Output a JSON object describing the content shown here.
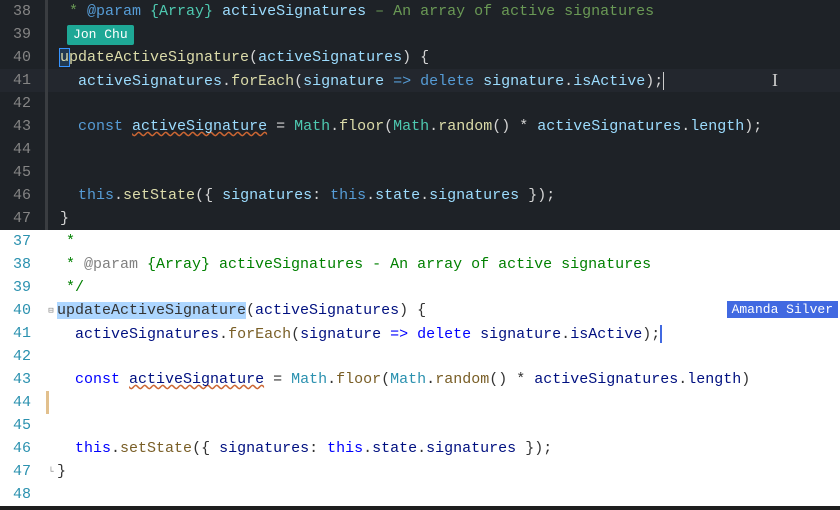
{
  "dark_pane": {
    "lines": {
      "38": {
        "num": "38",
        "comment_star": " * ",
        "tag": "@param",
        "type": "{Array}",
        "param": "activeSignatures",
        "desc": " – An array of active signatures"
      },
      "39": {
        "num": "39"
      },
      "blame": {
        "name": "Jon Chu"
      },
      "40": {
        "num": "40",
        "fn_pre": "u",
        "fn_rest": "pdateActiveSignature",
        "params": "activeSignatures",
        "brace": ") {"
      },
      "41": {
        "num": "41",
        "obj": "activeSignatures",
        "dot1": ".",
        "m1": "forEach",
        "open": "(",
        "p1": "signature",
        "arrow": " => ",
        "kw": "delete",
        "sp": " ",
        "p2": "signature",
        "dot2": ".",
        "prop": "isActive",
        "close": ");"
      },
      "42": {
        "num": "42"
      },
      "43": {
        "num": "43",
        "kw": "const",
        "var": "activeSignature",
        "eq": " = ",
        "math1": "Math",
        "dot1": ".",
        "m1": "floor",
        "open1": "(",
        "math2": "Math",
        "dot2": ".",
        "m2": "random",
        "call": "()",
        "mul": " * ",
        "obj": "activeSignatures",
        "dot3": ".",
        "prop": "length",
        "close": ");"
      },
      "44": {
        "num": "44"
      },
      "45": {
        "num": "45"
      },
      "46": {
        "num": "46",
        "this": "this",
        "dot1": ".",
        "m1": "setState",
        "open": "({ ",
        "key": "signatures",
        "colon": ": ",
        "this2": "this",
        "dot2": ".",
        "state": "state",
        "dot3": ".",
        "prop": "signatures",
        "close": " });"
      },
      "47": {
        "num": "47",
        "brace": "}"
      }
    }
  },
  "light_pane": {
    "blame": {
      "name": "Amanda Silver"
    },
    "lines": {
      "37": {
        "num": "37",
        "text": " *"
      },
      "38": {
        "num": "38",
        "star": " * ",
        "tag": "@param",
        "type": " {Array} ",
        "param": "activeSignatures",
        "desc": " - An array of active signatures"
      },
      "39": {
        "num": "39",
        "text": " */"
      },
      "40": {
        "num": "40",
        "fn": "updateActiveSignature",
        "open": "(",
        "params": "activeSignatures",
        "close": ") {"
      },
      "41": {
        "num": "41",
        "obj": "activeSignatures",
        "dot1": ".",
        "m1": "forEach",
        "open": "(",
        "p1": "signature",
        "arrow": " => ",
        "kw": "delete",
        "sp": " ",
        "p2": "signature",
        "dot2": ".",
        "prop": "isActive",
        "close": ");"
      },
      "42": {
        "num": "42"
      },
      "43": {
        "num": "43",
        "kw": "const",
        "var": "activeSignature",
        "eq": " = ",
        "math1": "Math",
        "dot1": ".",
        "m1": "floor",
        "open1": "(",
        "math2": "Math",
        "dot2": ".",
        "m2": "random",
        "call": "()",
        "mul": " * ",
        "obj": "activeSignatures",
        "dot3": ".",
        "prop": "length",
        "close": ")"
      },
      "44": {
        "num": "44"
      },
      "45": {
        "num": "45"
      },
      "46": {
        "num": "46",
        "this": "this",
        "dot1": ".",
        "m1": "setState",
        "open": "({ ",
        "key": "signatures",
        "colon": ": ",
        "this2": "this",
        "dot2": ".",
        "state": "state",
        "dot3": ".",
        "prop": "signatures",
        "close": " });"
      },
      "47": {
        "num": "47",
        "brace": "}"
      },
      "48": {
        "num": "48"
      }
    }
  }
}
